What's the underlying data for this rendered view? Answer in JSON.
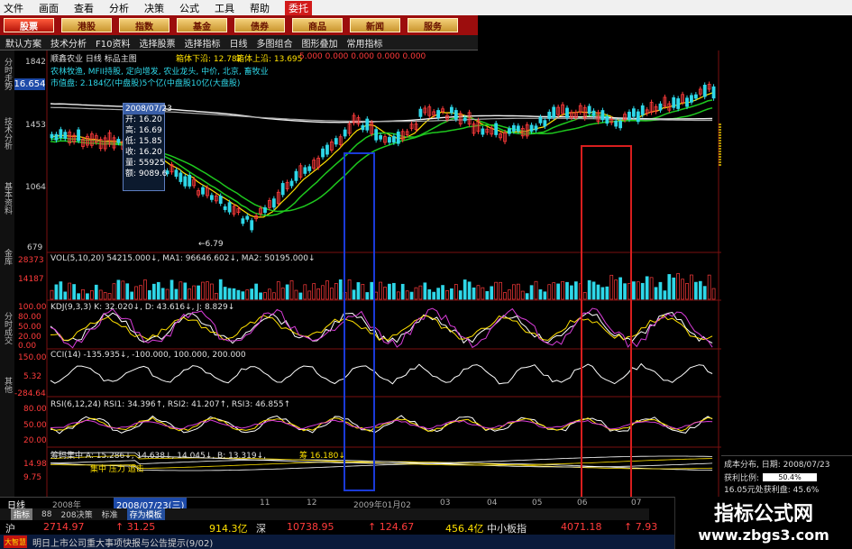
{
  "menu": {
    "items": [
      "文件",
      "画面",
      "查看",
      "分析",
      "决策",
      "公式",
      "工具",
      "帮助"
    ],
    "commission": "委托"
  },
  "tabs": [
    "股票",
    "港股",
    "指数",
    "基金",
    "债券",
    "商品",
    "新闻",
    "服务"
  ],
  "toolbar": [
    "默认方案",
    "技术分析",
    "F10资料",
    "选择股票",
    "选择指标",
    "日线",
    "多图组合",
    "图形叠加",
    "常用指标"
  ],
  "side_labels": [
    "分时走势",
    "技术分析",
    "基本资料",
    "金库",
    "分时成交",
    "其他"
  ],
  "price_tag": "16.654",
  "main_chart": {
    "header": "顺鑫农业 日线  标品主图",
    "box_down_label": "箱体下沿: 12.782",
    "box_up_label": "箱体上沿: 13.695",
    "ma_values": "5.000  0.000  0.000  0.000  0.000",
    "concept": "农林牧渔, MFII持股, 定向增发, 农业龙头, 中价, 北京, 畜牧业",
    "flow": "市值盘: 2.184亿(中盘股)5个亿(中盘股10亿(大盘股)",
    "yaxis": [
      "1842",
      "1453",
      "1064",
      "679"
    ],
    "low_label": "←6.79",
    "tooltip": {
      "date": "2008/07/23",
      "rows": [
        {
          "label": "开:",
          "value": "16.20"
        },
        {
          "label": "高:",
          "value": "16.69"
        },
        {
          "label": "低:",
          "value": "15.85"
        },
        {
          "label": "收:",
          "value": "16.20"
        },
        {
          "label": "量:",
          "value": "55925"
        },
        {
          "label": "额:",
          "value": "9089.6"
        }
      ]
    }
  },
  "vol": {
    "header": "VOL(5,10,20)  54215.000↓, MA1: 96646.602↓, MA2: 50195.000↓",
    "yaxis": [
      "28373",
      "14187"
    ]
  },
  "kdj": {
    "header": "KDJ(9,3,3)  K: 32.020↓, D: 43.616↓, J: 8.829↓",
    "yaxis": [
      "100.00",
      "80.00",
      "50.00",
      "20.00",
      "0.00"
    ]
  },
  "cci": {
    "header": "CCI(14)  -135.935↓, -100.000, 100.000, 200.000",
    "yaxis": [
      "150.00",
      "5.32",
      "-284.64"
    ]
  },
  "rsi": {
    "header": "RSI(6,12,24)  RSI1: 34.396↑, RSI2: 41.207↑, RSI3: 46.855↑",
    "yaxis": [
      "80.00",
      "50.00",
      "20.00"
    ]
  },
  "chip": {
    "header": "筹码集中  A: 15.286↓, 14.638↓, 14.045↓, B: 13.319↓,",
    "bottom_label": "筹 16.180↓",
    "yaxis": [
      "14.98",
      "9.75"
    ],
    "annotation": "集中 压力 追击"
  },
  "cost": {
    "title": "成本分布, 日期: 2008/07/23",
    "profit_label": "获利比例:",
    "profit_value": "50.4%",
    "note": "16.05元处获利盘: 45.6%"
  },
  "date_axis": {
    "timeline_label": "日线",
    "current_date": "2008/07/23(三)",
    "ticks": [
      "2008年",
      "11",
      "12",
      "2009年01月02",
      "03",
      "04",
      "05",
      "06",
      "07"
    ]
  },
  "subtabs": [
    "指标",
    "88",
    "208决策",
    "标准",
    "存为模板"
  ],
  "ticker": {
    "market1": "沪",
    "value1": "2714.97",
    "change1": "↑ 31.25",
    "amount1": "914.3亿",
    "market2": "深",
    "value2": "10738.95",
    "change2": "↑ 124.67",
    "amount2": "456.4亿",
    "market3": "中小板指",
    "value3": "4071.18",
    "change3": "↑ 7.93"
  },
  "news": {
    "icon_label": "大智慧",
    "text": "明日上市公司重大事项快报与公告提示(9/02)"
  },
  "watermark": {
    "title": "指标公式网",
    "url": "www.zbgs3.com"
  },
  "colors": {
    "red_box": "#d81e1e",
    "blue_box": "#1a3ad8",
    "up": "#ff3b3b",
    "down": "#2ed7e8",
    "ma_white": "#f0f0f0",
    "ma_green": "#1ec81e",
    "ma_yellow": "#ffe100"
  }
}
